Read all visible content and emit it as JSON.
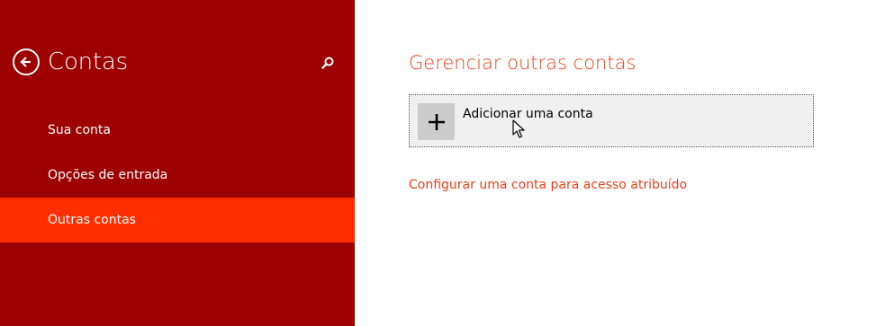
{
  "sidebar": {
    "title": "Contas",
    "back_icon": "back-arrow-icon",
    "search_icon": "search-icon",
    "items": [
      {
        "label": "Sua conta"
      },
      {
        "label": "Opções de entrada"
      },
      {
        "label": "Outras contas",
        "selected": true
      }
    ]
  },
  "main": {
    "title": "Gerenciar outras contas",
    "add_account": {
      "label": "Adicionar uma conta",
      "icon": "plus-icon"
    },
    "assigned_access_link": "Configurar uma conta para acesso atribuído"
  },
  "colors": {
    "sidebar_bg": "#9c0000",
    "selected_item_bg": "#ff2e00",
    "accent_text": "#e8401a",
    "button_bg": "#f0f0f0",
    "plus_box_bg": "#cccccc"
  }
}
